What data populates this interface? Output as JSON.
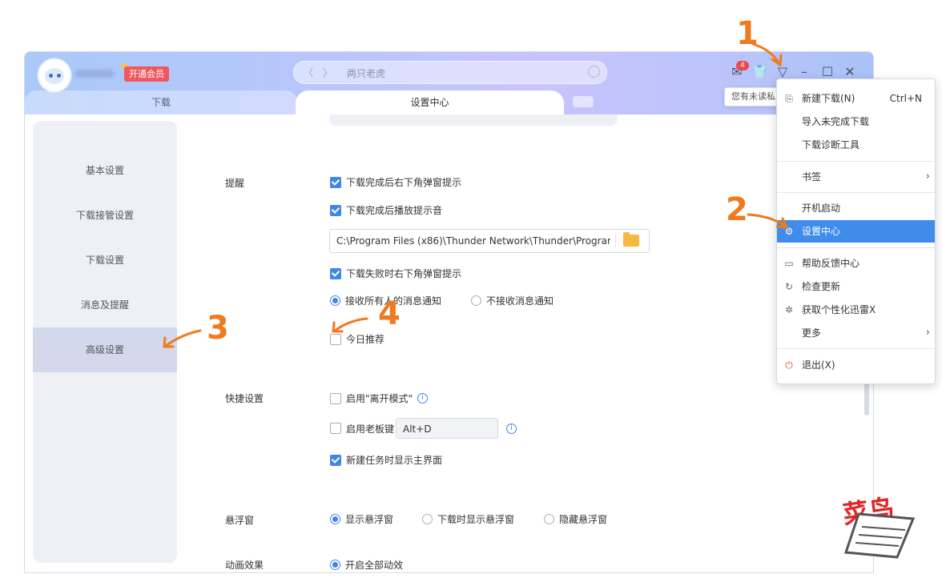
{
  "header": {
    "vip_label": "开通会员",
    "search_placeholder": "两只老虎",
    "mail_badge": "4",
    "tooltip": "您有未读私"
  },
  "tabs": [
    {
      "label": "下载"
    },
    {
      "label": "设置中心"
    }
  ],
  "sidebar": {
    "items": [
      {
        "label": "基本设置"
      },
      {
        "label": "下载接管设置"
      },
      {
        "label": "下载设置"
      },
      {
        "label": "消息及提醒"
      },
      {
        "label": "高级设置",
        "active": true
      }
    ]
  },
  "content": {
    "reminder": {
      "label": "提醒",
      "popup_on_complete": "下载完成后右下角弹窗提示",
      "sound_on_complete": "下载完成后播放提示音",
      "sound_path": "C:\\Program Files (x86)\\Thunder Network\\Thunder\\Program",
      "popup_on_fail": "下载失败时右下角弹窗提示",
      "receive_all": "接收所有人的消息通知",
      "receive_none": "不接收消息通知",
      "today_recommend": "今日推荐"
    },
    "shortcuts": {
      "label": "快捷设置",
      "away_mode": "启用\"离开模式\"",
      "boss_key": "启用老板键",
      "boss_key_value": "Alt+D",
      "show_main_on_new": "新建任务时显示主界面"
    },
    "floating": {
      "label": "悬浮窗",
      "show": "显示悬浮窗",
      "show_when_downloading": "下载时显示悬浮窗",
      "hide": "隐藏悬浮窗"
    },
    "animation": {
      "label": "动画效果",
      "enable_all": "开启全部动效"
    }
  },
  "menu": {
    "items": [
      {
        "label": "新建下载(N)",
        "shortcut": "Ctrl+N",
        "icon": "new-download-icon"
      },
      {
        "label": "导入未完成下载"
      },
      {
        "label": "下载诊断工具"
      },
      {
        "label": "书签",
        "submenu": true
      },
      {
        "label": "开机启动"
      },
      {
        "label": "设置中心",
        "icon": "gear-icon",
        "highlighted": true
      },
      {
        "label": "帮助反馈中心",
        "icon": "feedback-icon"
      },
      {
        "label": "检查更新",
        "icon": "refresh-icon"
      },
      {
        "label": "获取个性化迅雷X",
        "icon": "magic-wand-icon"
      },
      {
        "label": "更多",
        "submenu": true
      },
      {
        "label": "退出(X)",
        "icon": "power-icon"
      }
    ]
  },
  "annotations": {
    "step1": "1",
    "step2": "2",
    "step3": "3",
    "step4": "4",
    "color": "#f07a1e"
  },
  "watermark": {
    "text": "菜鸟"
  }
}
